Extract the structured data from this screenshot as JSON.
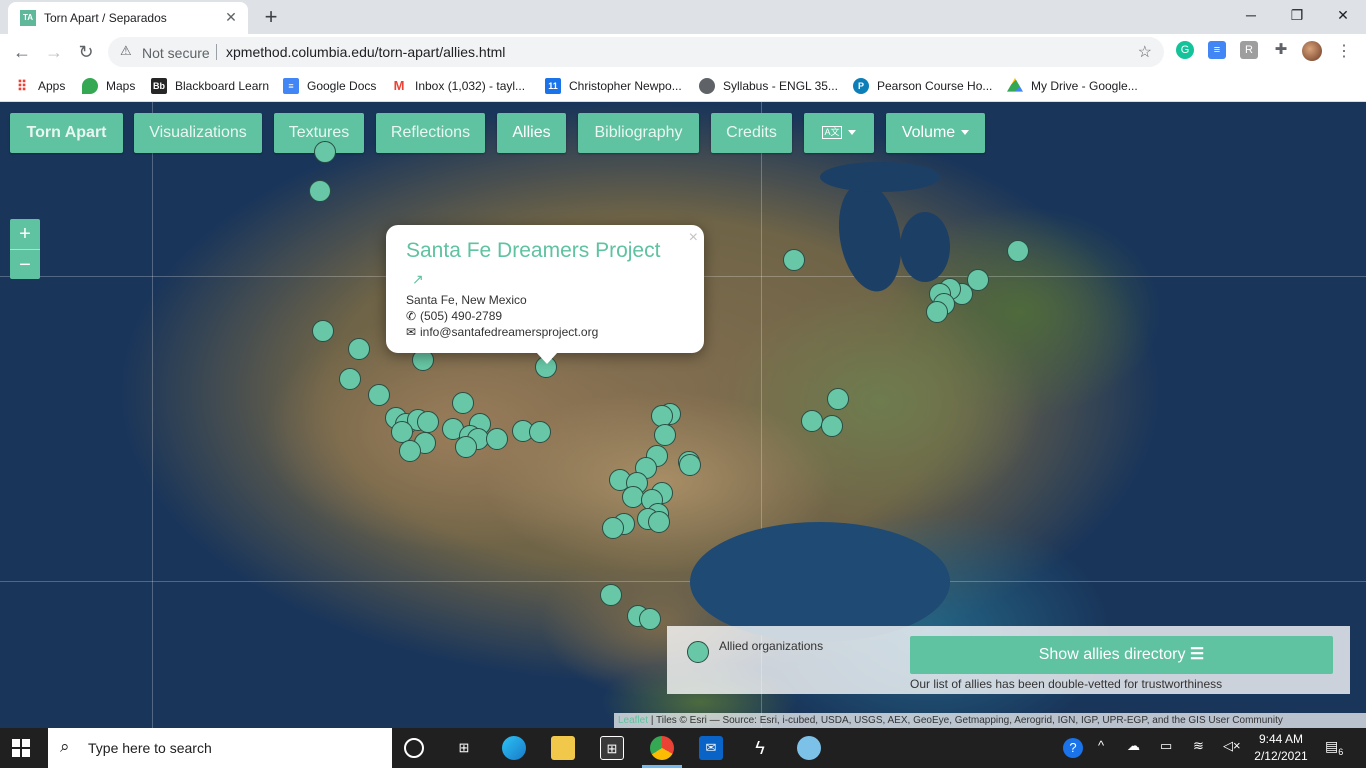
{
  "browser": {
    "tab_title": "Torn Apart / Separados",
    "tab_favicon_text": "TA S",
    "new_tab": "+",
    "security_label": "Not secure",
    "url": "xpmethod.columbia.edu/torn-apart/allies.html",
    "bookmarks": [
      {
        "label": "Apps",
        "icon": "apps-grid-icon",
        "color": "#ea4335"
      },
      {
        "label": "Maps",
        "icon": "maps-pin-icon",
        "color": "#34a853"
      },
      {
        "label": "Blackboard Learn",
        "icon": "blackboard-icon",
        "color": "#262626"
      },
      {
        "label": "Google Docs",
        "icon": "google-docs-icon",
        "color": "#4285f4"
      },
      {
        "label": "Inbox (1,032) - tayl...",
        "icon": "gmail-icon",
        "color": "#ea4335"
      },
      {
        "label": "Christopher Newpo...",
        "icon": "calendar-icon",
        "color": "#1a73e8"
      },
      {
        "label": "Syllabus - ENGL 35...",
        "icon": "globe-icon",
        "color": "#5f6368"
      },
      {
        "label": "Pearson Course Ho...",
        "icon": "pearson-icon",
        "color": "#0d7fb8"
      },
      {
        "label": "My Drive - Google...",
        "icon": "google-drive-icon",
        "color": "#fbbc04"
      }
    ]
  },
  "site": {
    "nav": [
      {
        "label": "Torn Apart",
        "name": "nav-torn-apart"
      },
      {
        "label": "Visualizations",
        "name": "nav-visualizations"
      },
      {
        "label": "Textures",
        "name": "nav-textures"
      },
      {
        "label": "Reflections",
        "name": "nav-reflections"
      },
      {
        "label": "Allies",
        "name": "nav-allies"
      },
      {
        "label": "Bibliography",
        "name": "nav-bibliography"
      },
      {
        "label": "Credits",
        "name": "nav-credits"
      },
      {
        "label": "Volume",
        "name": "nav-volume"
      }
    ],
    "zoom_in": "+",
    "zoom_out": "−",
    "accent_color": "#5fc2a0"
  },
  "popup": {
    "title": "Santa Fe Dreamers Project",
    "location": "Santa Fe, New Mexico",
    "phone": "(505) 490-2789",
    "email": "info@santafedreamersproject.org",
    "close": "×"
  },
  "legend": {
    "label": "Allied organizations",
    "button": "Show allies directory",
    "note": "Our list of allies has been double-vetted for trustworthiness"
  },
  "attribution": {
    "leaflet": "Leaflet",
    "text": "| Tiles © Esri — Source: Esri, i-cubed, USDA, USGS, AEX, GeoEye, Getmapping, Aerogrid, IGN, IGP, UPR-EGP, and the GIS User Community"
  },
  "taskbar": {
    "search_placeholder": "Type here to search",
    "time": "9:44 AM",
    "date": "2/12/2021",
    "notifications": "6"
  }
}
